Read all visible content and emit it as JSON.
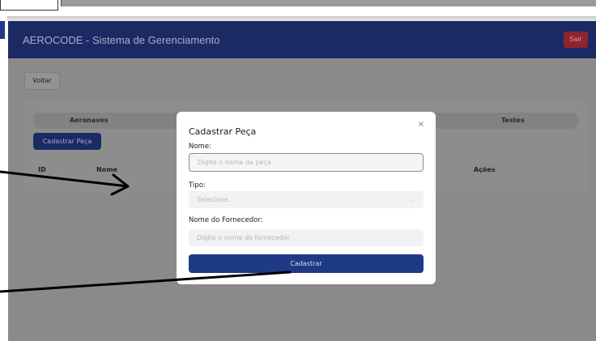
{
  "app": {
    "title": "AEROCODE - Sistema de Gerenciamento",
    "logout_label": "Sair",
    "back_label": "Voltar"
  },
  "panel": {
    "tabs": [
      "Aeronaves",
      "Testes"
    ],
    "add_part_label": "Cadastrar Peça",
    "columns": [
      "ID",
      "Nome",
      "Ações"
    ]
  },
  "modal": {
    "title": "Cadastrar Peça",
    "close_symbol": "×",
    "fields": {
      "name_label": "Nome:",
      "name_placeholder": "Digite o nome da peça",
      "type_label": "Tipo:",
      "type_placeholder": "Selecione...",
      "supplier_label": "Nome do Fornecedor:",
      "supplier_placeholder": "Digite o nome do fornecedor"
    },
    "submit_label": "Cadastrar"
  },
  "colors": {
    "header": "#1c2a64",
    "logout": "#8f2430",
    "primary_button": "#1e3a86"
  },
  "icons": {
    "close": "close-icon",
    "select_chevron": "chevron-down-icon",
    "annotation_arrows": "arrow-icon"
  }
}
